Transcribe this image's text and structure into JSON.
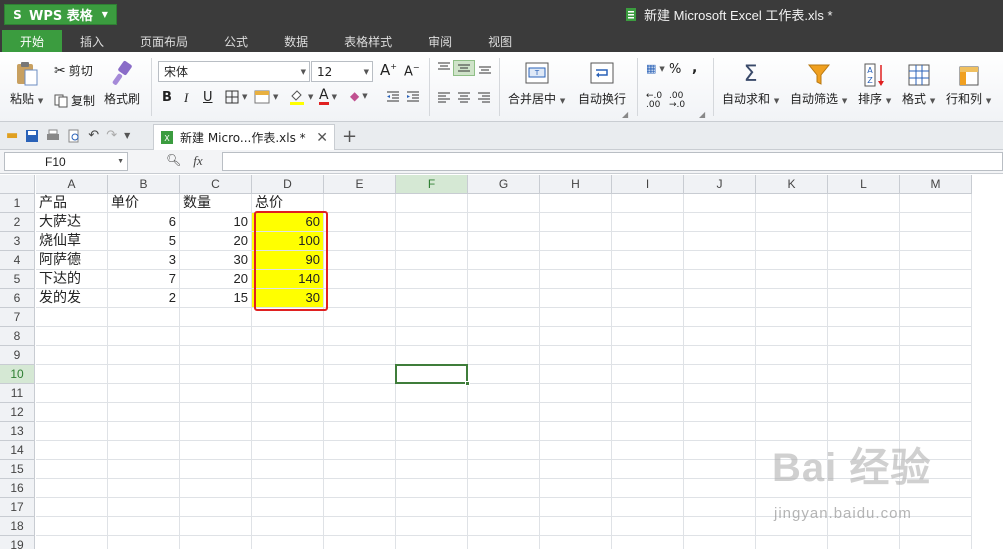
{
  "app": {
    "menu_button": "WPS 表格",
    "window_title": "新建 Microsoft Excel 工作表.xls *"
  },
  "menu": {
    "tabs": [
      "开始",
      "插入",
      "页面布局",
      "公式",
      "数据",
      "表格样式",
      "审阅",
      "视图"
    ],
    "active_tab": "开始"
  },
  "ribbon": {
    "paste": "粘贴",
    "cut": "剪切",
    "copy": "复制",
    "format_painter": "格式刷",
    "font_name": "宋体",
    "font_size": "12",
    "bold": "B",
    "italic": "I",
    "underline": "U",
    "merge_center": "合并居中",
    "wrap_text": "自动换行",
    "percent": "%",
    "comma": ",",
    "autosum": "自动求和",
    "autofilter": "自动筛选",
    "sort": "排序",
    "format": "格式",
    "rows_cols": "行和列"
  },
  "doc_tab": {
    "label": "新建 Micro...作表.xls *"
  },
  "formula_bar": {
    "name_box": "F10",
    "formula": ""
  },
  "sheet": {
    "columns": [
      "A",
      "B",
      "C",
      "D",
      "E",
      "F",
      "G",
      "H",
      "I",
      "J",
      "K",
      "L",
      "M"
    ],
    "selected_column": "F",
    "row_numbers": [
      "1",
      "2",
      "3",
      "4",
      "5",
      "6",
      "7",
      "8",
      "9",
      "10",
      "11",
      "12",
      "13",
      "14",
      "15",
      "16",
      "17",
      "18",
      "19"
    ],
    "selected_row": "10",
    "rows": [
      [
        "产品",
        "单价",
        "数量",
        "总价"
      ],
      [
        "大萨达",
        "6",
        "10",
        "60"
      ],
      [
        "烧仙草",
        "5",
        "20",
        "100"
      ],
      [
        "阿萨德",
        "3",
        "30",
        "90"
      ],
      [
        "下达的",
        "7",
        "20",
        "140"
      ],
      [
        "发的发",
        "2",
        "15",
        "30"
      ]
    ],
    "highlight_color": "#ffff00",
    "highlight_border_color": "#e02020",
    "active_cell": "F10"
  },
  "colors": {
    "wps_green": "#3b9c3f",
    "titlebar": "#3b3b3b"
  },
  "watermark": {
    "main": "Bai 经验",
    "url": "jingyan.baidu.com"
  }
}
